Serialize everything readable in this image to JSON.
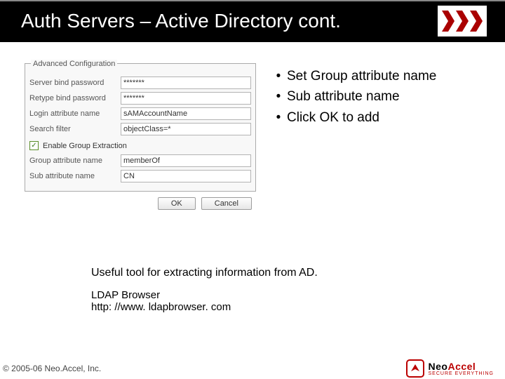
{
  "title": "Auth Servers – Active Directory cont.",
  "form": {
    "legend": "Advanced Configuration",
    "rows": {
      "bind_pw_label": "Server bind password",
      "bind_pw_value": "*******",
      "retype_pw_label": "Retype bind password",
      "retype_pw_value": "*******",
      "login_attr_label": "Login attribute name",
      "login_attr_value": "sAMAccountName",
      "search_filter_label": "Search filter",
      "search_filter_value": "objectClass=*",
      "enable_group_label": "Enable Group Extraction",
      "group_attr_label": "Group attribute name",
      "group_attr_value": "memberOf",
      "sub_attr_label": "Sub attribute name",
      "sub_attr_value": "CN"
    },
    "buttons": {
      "ok": "OK",
      "cancel": "Cancel"
    }
  },
  "bullets": [
    "Set Group attribute name",
    "Sub attribute name",
    "Click OK to add"
  ],
  "note": {
    "heading": "Useful tool for extracting information from AD.",
    "tool": "LDAP Browser",
    "url": "http: //www. ldapbrowser. com"
  },
  "footer": {
    "copyright": "© 2005-06 Neo.Accel, Inc.",
    "logo_neo": "Neo",
    "logo_accel": "Accel",
    "logo_tag": "SECURE EVERYTHING"
  }
}
